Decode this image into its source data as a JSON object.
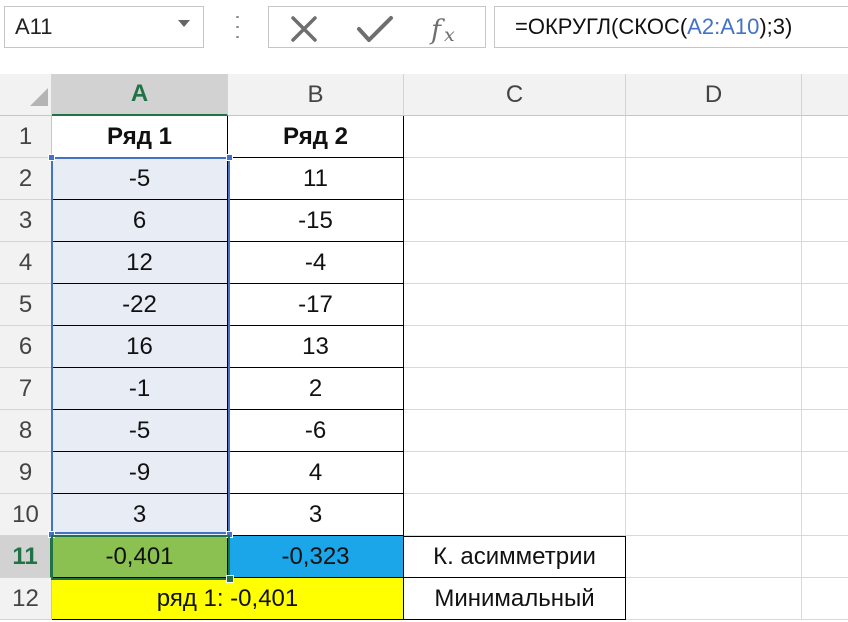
{
  "name_box": "A11",
  "formula": {
    "prefix": "=ОКРУГЛ(СКОС(",
    "ref": "A2:A10",
    "suffix": ");3)"
  },
  "columns": [
    "A",
    "B",
    "C",
    "D"
  ],
  "rows": [
    "1",
    "2",
    "3",
    "4",
    "5",
    "6",
    "7",
    "8",
    "9",
    "10",
    "11",
    "12"
  ],
  "cells": {
    "header": [
      "Ряд 1",
      "Ряд 2"
    ],
    "series1": [
      "-5",
      "6",
      "12",
      "-22",
      "16",
      "-1",
      "-5",
      "-9",
      "3"
    ],
    "series2": [
      "11",
      "-15",
      "-4",
      "-17",
      "13",
      "2",
      "-6",
      "4",
      "3"
    ],
    "r11": {
      "a": "-0,401",
      "b": "-0,323",
      "c": "К. асимметрии"
    },
    "r12": {
      "ab": "ряд 1: -0,401",
      "c": "Минимальный"
    }
  },
  "colors": {
    "a11_fill": "#8ac150",
    "b11_fill": "#1aa6e8",
    "r12_fill": "#ffff00",
    "selection": "#4472c4",
    "active": "#217346"
  }
}
